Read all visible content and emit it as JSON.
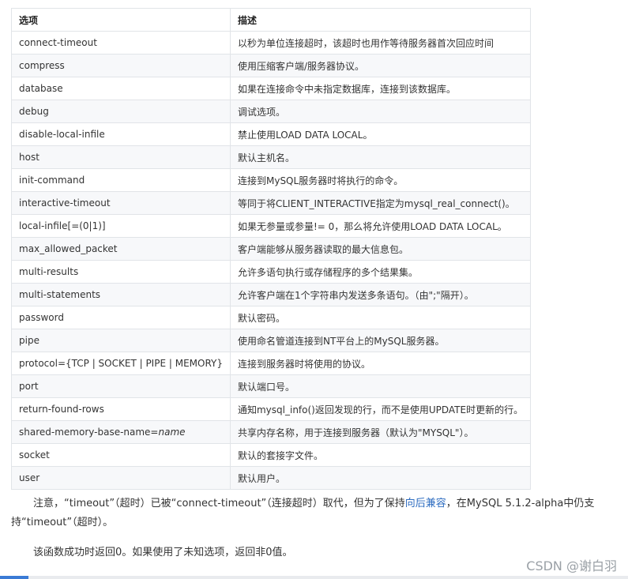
{
  "table": {
    "headers": [
      "选项",
      "描述"
    ],
    "rows": [
      {
        "option": "connect-timeout",
        "desc": "以秒为单位连接超时，该超时也用作等待服务器首次回应时间"
      },
      {
        "option": "compress",
        "desc": "使用压缩客户端/服务器协议。"
      },
      {
        "option": "database",
        "desc": "如果在连接命令中未指定数据库，连接到该数据库。"
      },
      {
        "option": "debug",
        "desc": "调试选项。"
      },
      {
        "option": "disable-local-infile",
        "desc": "禁止使用LOAD DATA LOCAL。"
      },
      {
        "option": "host",
        "desc": "默认主机名。"
      },
      {
        "option": "init-command",
        "desc": "连接到MySQL服务器时将执行的命令。"
      },
      {
        "option": "interactive-timeout",
        "desc": "等同于将CLIENT_INTERACTIVE指定为mysql_real_connect()。"
      },
      {
        "option": "local-infile[=(0|1)]",
        "desc": "如果无参量或参量!= 0，那么将允许使用LOAD DATA LOCAL。"
      },
      {
        "option": "max_allowed_packet",
        "desc": "客户端能够从服务器读取的最大信息包。"
      },
      {
        "option": "multi-results",
        "desc": "允许多语句执行或存储程序的多个结果集。"
      },
      {
        "option": "multi-statements",
        "desc": "允许客户端在1个字符串内发送多条语句。（由\";\"隔开）。"
      },
      {
        "option": "password",
        "desc": "默认密码。"
      },
      {
        "option": "pipe",
        "desc": "使用命名管道连接到NT平台上的MySQL服务器。"
      },
      {
        "option": "protocol={TCP | SOCKET | PIPE | MEMORY}",
        "desc": "连接到服务器时将使用的协议。"
      },
      {
        "option": "port",
        "desc": "默认端口号。"
      },
      {
        "option": "return-found-rows",
        "desc": "通知mysql_info()返回发现的行，而不是使用UPDATE时更新的行。"
      },
      {
        "option": "shared-memory-base-name=",
        "option_italic": "name",
        "desc": "共享内存名称，用于连接到服务器（默认为\"MYSQL\"）。"
      },
      {
        "option": "socket",
        "desc": "默认的套接字文件。"
      },
      {
        "option": "user",
        "desc": "默认用户。"
      }
    ]
  },
  "note1": {
    "before": "注意，“timeout”（超时）已被“connect-timeout”（连接超时）取代，但为了保持",
    "link": "向后兼容",
    "after": "，在MySQL 5.1.2-alpha中仍支持“timeout”（超时）。"
  },
  "note2": "该函数成功时返回0。如果使用了未知选项，返回非0值。",
  "watermark": "CSDN @谢白羽",
  "colors": {
    "link": "#2d6cc0",
    "border": "#e1e4e8",
    "stripe": "#f7f8fa"
  }
}
